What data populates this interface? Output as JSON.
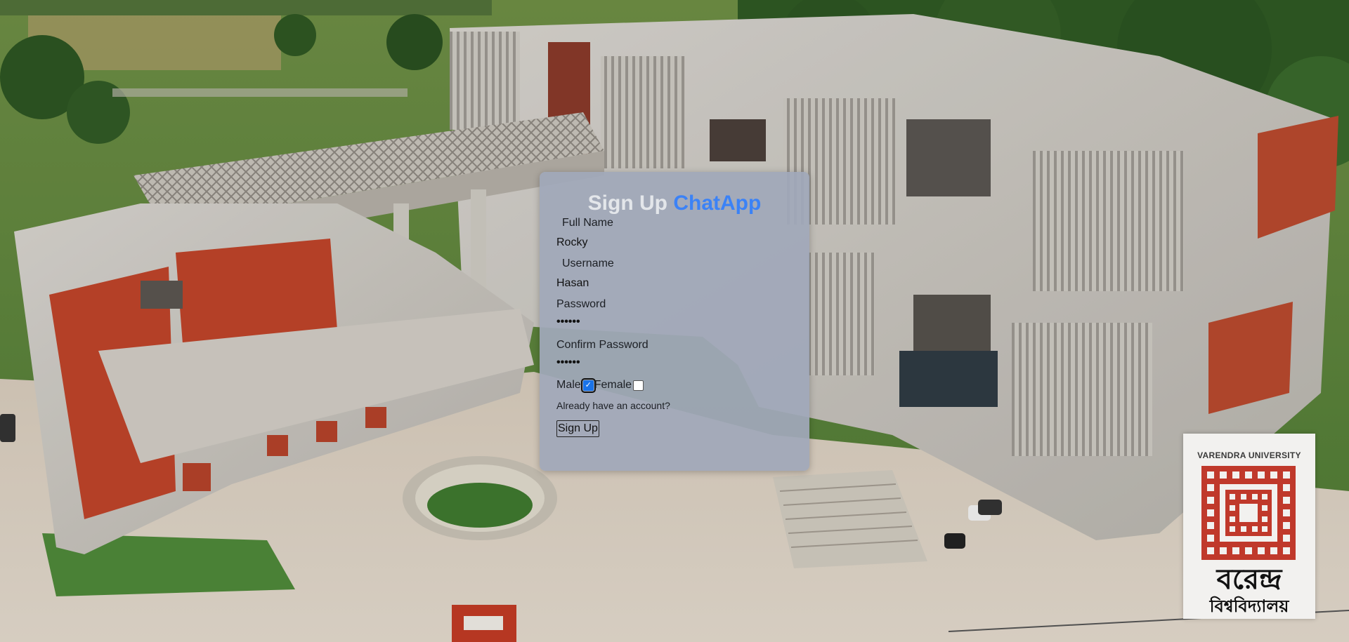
{
  "form": {
    "title_part1": "Sign Up",
    "title_part2": "ChatApp",
    "full_name_label": "Full Name",
    "full_name_value": "Rocky",
    "username_label": "Username",
    "username_value": "Hasan",
    "password_label": "Password",
    "password_value": "••••••",
    "confirm_password_label": "Confirm Password",
    "confirm_password_value": "••••••",
    "gender_male_label": "Male",
    "gender_female_label": "Female",
    "gender_male_checked": true,
    "gender_female_checked": false,
    "login_link": "Already have an account?",
    "submit_label": "Sign Up"
  },
  "logo": {
    "name": "VARENDRA UNIVERSITY",
    "bangla_line1": "বরেন্দ্র",
    "bangla_line2": "বিশ্ববিদ্যালয়"
  },
  "colors": {
    "accent": "#3b82f6",
    "title_light": "#e3e6ea",
    "card_bg": "#a0a8b9",
    "logo_red": "#c0392b",
    "brick": "#c0442a"
  },
  "icons": {
    "male_checkbox": "checkbox-checked-icon",
    "female_checkbox": "checkbox-unchecked-icon"
  }
}
